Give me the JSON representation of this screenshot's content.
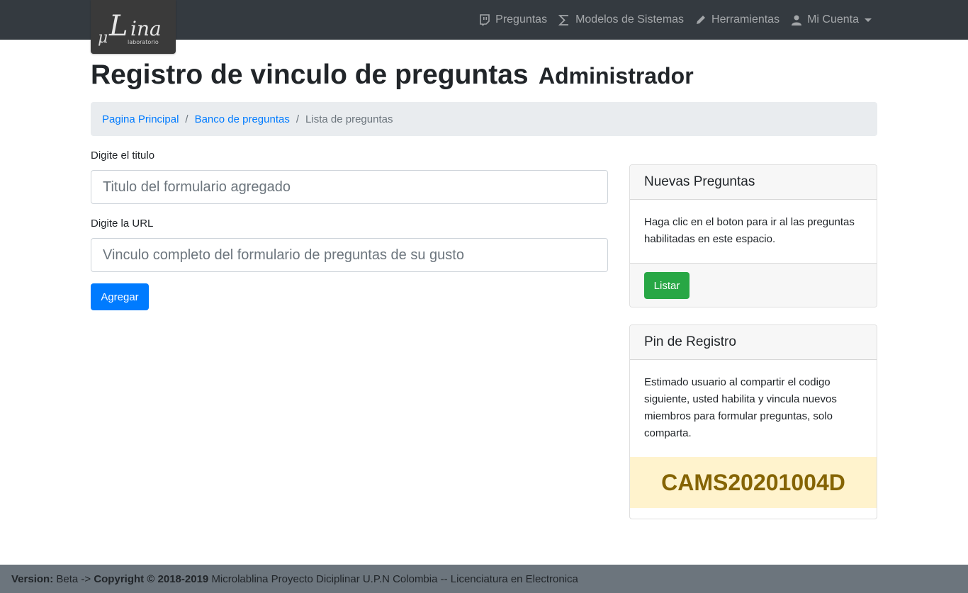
{
  "brand": {
    "logo_text": "μLina",
    "logo_subtext": "laboratorio"
  },
  "nav": [
    {
      "label": "Preguntas",
      "icon": "twitch-icon"
    },
    {
      "label": "Modelos de Sistemas",
      "icon": "sigma-icon"
    },
    {
      "label": "Herramientas",
      "icon": "pencil-icon"
    },
    {
      "label": "Mi Cuenta",
      "icon": "user-icon",
      "dropdown": true
    }
  ],
  "page": {
    "title": "Registro de vinculo de preguntas",
    "subtitle": "Administrador"
  },
  "breadcrumb": {
    "home": "Pagina Principal",
    "bank": "Banco de preguntas",
    "current": "Lista de preguntas",
    "separator": "/"
  },
  "form": {
    "title_label": "Digite el titulo",
    "title_placeholder": "Titulo del formulario agregado",
    "url_label": "Digite la URL",
    "url_placeholder": "Vinculo completo del formulario de preguntas de su gusto",
    "submit_label": "Agregar"
  },
  "card_new": {
    "header": "Nuevas Preguntas",
    "body": "Haga clic en el boton para ir al las preguntas habilitadas en este espacio.",
    "button_label": "Listar"
  },
  "card_pin": {
    "header": "Pin de Registro",
    "body": "Estimado usuario al compartir el codigo siguiente, usted habilita y vincula nuevos miembros para formular preguntas, solo comparta.",
    "pin": "CAMS20201004D"
  },
  "footer": {
    "version_label": "Version:",
    "version_value": "Beta ->",
    "copyright_label": "Copyright © 2018-2019",
    "copyright_text": "Microlablina Proyecto Diciplinar U.P.N Colombia -- Licenciatura en Electronica"
  },
  "colors": {
    "navbar": "#343a40",
    "primary": "#007bff",
    "success": "#28a745",
    "pin_bg": "#fff3cd",
    "pin_text": "#856404",
    "footer": "#6c757d"
  }
}
